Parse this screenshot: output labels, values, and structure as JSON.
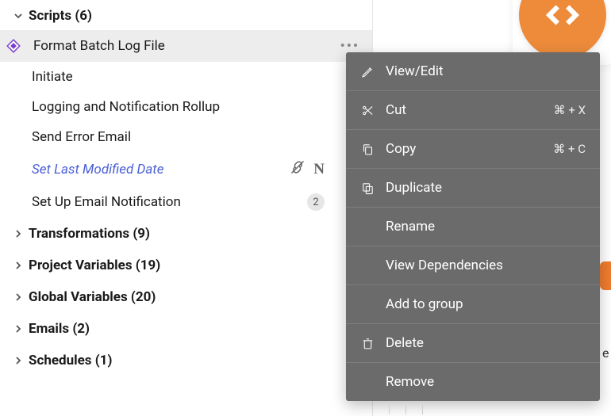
{
  "sidebar": {
    "scripts": {
      "header": "Scripts (6)",
      "items": [
        {
          "label": "Format Batch Log File"
        },
        {
          "label": "Initiate"
        },
        {
          "label": "Logging and Notification Rollup"
        },
        {
          "label": "Send Error Email"
        },
        {
          "label": "Set Last Modified Date"
        },
        {
          "label": "Set Up Email Notification",
          "badge": "2"
        }
      ]
    },
    "categories": [
      {
        "label": "Transformations (9)"
      },
      {
        "label": "Project Variables (19)"
      },
      {
        "label": "Global Variables (20)"
      },
      {
        "label": "Emails (2)"
      },
      {
        "label": "Schedules (1)"
      }
    ]
  },
  "ellipsis_glyph": "•••",
  "context_menu": {
    "items": [
      {
        "label": "View/Edit",
        "icon": "pencil"
      },
      {
        "label": "Cut",
        "icon": "scissors",
        "shortcut": "⌘ + X"
      },
      {
        "label": "Copy",
        "icon": "copy",
        "shortcut": "⌘ + C"
      },
      {
        "label": "Duplicate",
        "icon": "duplicate"
      },
      {
        "label": "Rename"
      },
      {
        "label": "View Dependencies"
      },
      {
        "label": "Add to group"
      },
      {
        "label": "Delete",
        "icon": "trash"
      },
      {
        "label": "Remove"
      }
    ]
  },
  "stray_char": "e"
}
